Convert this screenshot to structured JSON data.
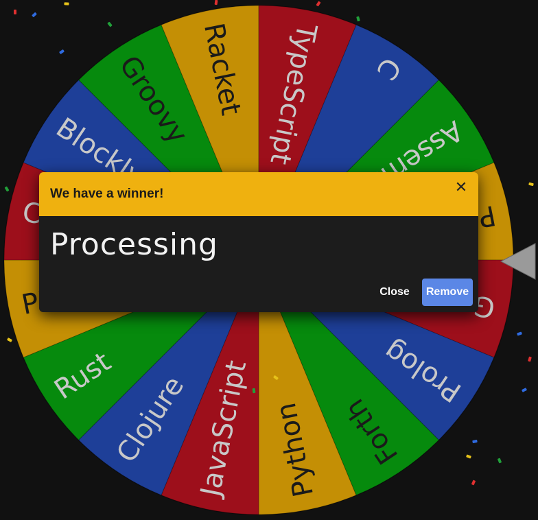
{
  "wheel": {
    "segments": [
      {
        "label": "C",
        "color": "#1e3f98",
        "text_color": "#c8c8c8"
      },
      {
        "label": "Assembly",
        "color": "#068a0d",
        "text_color": "#c8c8c8"
      },
      {
        "label": "Processing",
        "color": "#c48f05",
        "text_color": "#1a1a1a"
      },
      {
        "label": "Go",
        "color": "#9d0f1b",
        "text_color": "#c8c8c8"
      },
      {
        "label": "Prolog",
        "color": "#1e3f98",
        "text_color": "#c8c8c8"
      },
      {
        "label": "Forth",
        "color": "#068a0d",
        "text_color": "#1a1a1a"
      },
      {
        "label": "Python",
        "color": "#c48f05",
        "text_color": "#1a1a1a"
      },
      {
        "label": "JavaScript",
        "color": "#9d0f1b",
        "text_color": "#c8c8c8"
      },
      {
        "label": "Clojure",
        "color": "#1e3f98",
        "text_color": "#c8c8c8"
      },
      {
        "label": "Rust",
        "color": "#068a0d",
        "text_color": "#c8c8c8"
      },
      {
        "label": "PHP",
        "color": "#c48f05",
        "text_color": "#1a1a1a"
      },
      {
        "label": "C#",
        "color": "#9d0f1b",
        "text_color": "#c8c8c8"
      },
      {
        "label": "Blockly",
        "color": "#1e3f98",
        "text_color": "#c8c8c8"
      },
      {
        "label": "Groovy",
        "color": "#068a0d",
        "text_color": "#1a1a1a"
      },
      {
        "label": "Racket",
        "color": "#c48f05",
        "text_color": "#1a1a1a"
      },
      {
        "label": "TypeScript",
        "color": "#9d0f1b",
        "text_color": "#c8c8c8"
      }
    ],
    "pointer_icon": "pointer-triangle-icon",
    "confetti_colors": [
      "#e03030",
      "#2f6be0",
      "#e6c21a",
      "#21a03a"
    ]
  },
  "dialog": {
    "title": "We have a winner!",
    "close_icon": "close-icon",
    "close_glyph": "✕",
    "winner": "Processing",
    "close_button_label": "Close",
    "remove_button_label": "Remove",
    "header_color": "#efb10f",
    "remove_button_color": "#5b87e6"
  }
}
